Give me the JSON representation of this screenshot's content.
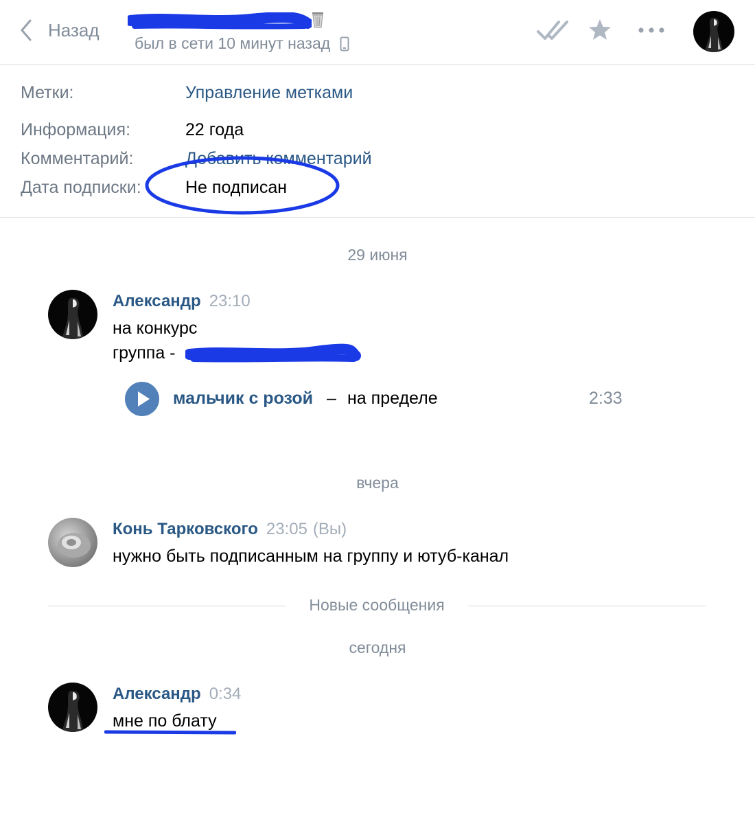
{
  "header": {
    "back_label": "Назад",
    "status": "был в сети 10 минут назад",
    "icons": [
      "chevron-left-icon",
      "trash-icon",
      "phone-icon",
      "double-check-icon",
      "star-icon",
      "more-icon"
    ]
  },
  "info": {
    "rows": [
      {
        "label": "Метки:",
        "value": "Управление метками"
      },
      {
        "label": "Информация:",
        "value": "22 года"
      },
      {
        "label": "Комментарий:",
        "value": "Добавить комментарий"
      },
      {
        "label": "Дата подписки:",
        "value": "Не подписан"
      }
    ]
  },
  "dates": {
    "first": "29 июня",
    "second": "вчера",
    "third": "сегодня"
  },
  "messages": [
    {
      "author": "Александр",
      "time": "23:10",
      "lines": [
        "на конкурс",
        "группа -"
      ]
    },
    {
      "author": "Конь Тарковского",
      "time": "23:05",
      "you": "(Вы)",
      "lines": [
        "нужно быть подписанным на группу и ютуб-канал"
      ]
    },
    {
      "author": "Александр",
      "time": "0:34",
      "lines": [
        "мне по блату"
      ]
    }
  ],
  "audio": {
    "artist": "мальчик с розой",
    "separator": "–",
    "title": "на пределе",
    "duration": "2:33"
  },
  "new_messages_label": "Новые сообщения",
  "colors": {
    "link": "#2a5885",
    "muted": "#818c99",
    "play": "#5181b8",
    "annotation": "#1a3ae6"
  }
}
